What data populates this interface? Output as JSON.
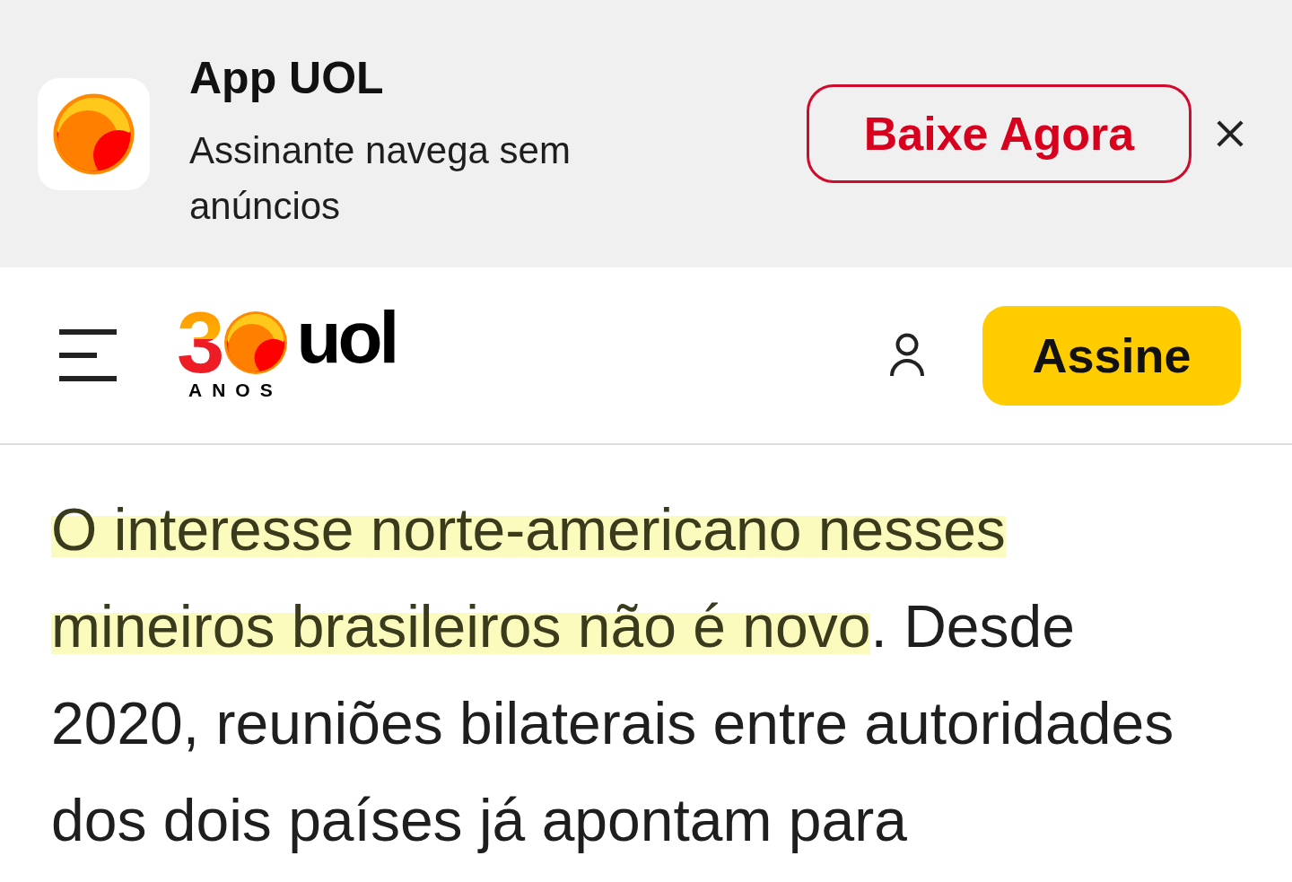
{
  "app_banner": {
    "title": "App UOL",
    "subtitle": "Assinante navega sem anúncios",
    "button": "Baixe Agora"
  },
  "header": {
    "logo": {
      "number": "3",
      "wordmark": "uol",
      "tagline": "ANOS"
    },
    "button": "Assine"
  },
  "article": {
    "paragraph": [
      {
        "text": "O interesse norte-americano nesses mineiros brasileiros não é novo",
        "highlighted": true
      },
      {
        "text": ". Desde 2020, reuniões bilaterais entre autoridades dos dois países já apontam para",
        "highlighted": false
      }
    ]
  }
}
